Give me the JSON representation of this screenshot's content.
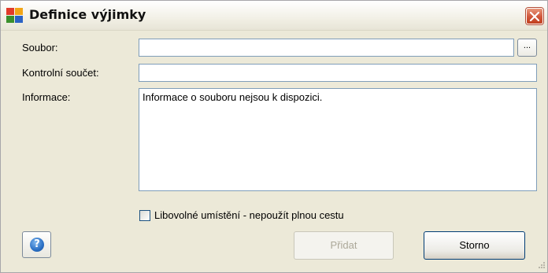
{
  "window": {
    "title": "Definice výjimky",
    "close_label": "Close"
  },
  "form": {
    "file_label": "Soubor:",
    "file_value": "",
    "browse_label": "...",
    "checksum_label": "Kontrolní součet:",
    "checksum_value": "",
    "info_label": "Informace:",
    "info_value": "Informace o souboru nejsou k dispozici.",
    "anywhere_checkbox_label": "Libovolné umístění - nepoužít plnou cestu",
    "anywhere_checked": false
  },
  "buttons": {
    "help_glyph": "?",
    "add_label": "Přidat",
    "cancel_label": "Storno"
  },
  "icons": {
    "app": "avg-app-icon",
    "close": "close-icon",
    "help": "help-icon"
  },
  "colors": {
    "close_button": "#d0563a",
    "help_icon": "#2a6fc4",
    "textbox_border": "#7f9db9"
  }
}
